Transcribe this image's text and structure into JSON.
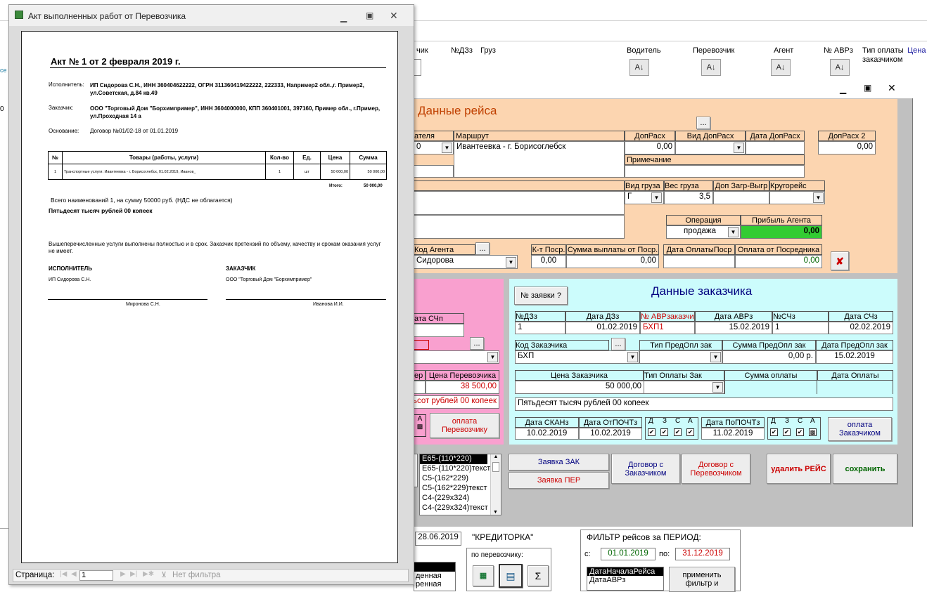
{
  "bg_headers": {
    "col1": "чик",
    "col2": "№ДЗз",
    "col3": "Груз",
    "col4": "Водитель",
    "col5": "Перевозчик",
    "col6": "Агент",
    "col7": "№ АВРз",
    "col8": "Тип оплаты заказчиком",
    "col9": "Цена"
  },
  "reis": {
    "title": "Данные рейса",
    "hdr_driver": "ателя",
    "hdr_route": "Маршрут",
    "hdr_dopras": "ДопРасх",
    "hdr_vid_dopras": "Вид ДопРасх",
    "hdr_date_dopras": "Дата ДопРасх",
    "hdr_dopras2": "ДопРасх 2",
    "driver_val": "0",
    "route_val": "Ивантеевка - г. Борисоглебск",
    "dopras_val": "0,00",
    "dopras2_val": "0,00",
    "hdr_note": "Примечание",
    "note_val": "",
    "hdr_vid_gruza": "Вид груза",
    "hdr_ves": "Вес груза",
    "hdr_dop_zagr": "Доп Загр-Выгр",
    "hdr_krug": "Кругорейс",
    "vid_gruza_val": "Г",
    "ves_val": "3,5",
    "hdr_operacia": "Операция",
    "hdr_pribyl": "Прибыль Агента",
    "operacia_val": "продажа",
    "pribyl_val": "0,00",
    "hdr_kod_agenta": "Код Агента",
    "kod_agenta_val": "Сидорова",
    "hdr_kt": "К-т Поср.",
    "hdr_summa_vypl": "Сумма выплаты от Поср.",
    "hdr_data_opl_posr": "Дата ОплатыПоср",
    "hdr_opl_ot_posr": "Оплата от Посредника",
    "kt_val": "0,00",
    "summa_vypl_val": "0,00",
    "opl_ot_posr_val": "0,00",
    "ellipsis": "..."
  },
  "carrier": {
    "hdr_data_schp": "ата СЧп",
    "hdr_nomer": "ер",
    "hdr_cena": "Цена Перевозчика",
    "cena_val": "38 500,00",
    "words": "тьсот рублей 00 копеек",
    "a_label": "А",
    "opl_button": "оплата Перевозчику"
  },
  "customer": {
    "title": "Данные заказчика",
    "zayavki_btn": "№ заявки ?",
    "hdr_ndzz": "№ДЗз",
    "hdr_data_dzz": "Дата ДЗз",
    "hdr_avr": "№ АВРзаказчи",
    "hdr_data_avr": "Дата АВРз",
    "hdr_nsch": "№СЧз",
    "hdr_data_sch": "Дата СЧз",
    "ndzz_val": "1",
    "data_dzz_val": "01.02.2019",
    "avr_val": "БХП1",
    "data_avr_val": "15.02.2019",
    "nsch_val": "1",
    "data_sch_val": "02.02.2019",
    "hdr_kod": "Код Заказчика",
    "hdr_tip_predopl": "Тип ПредОпл зак",
    "hdr_summa_predopl": "Сумма ПредОпл зак",
    "hdr_data_predopl": "Дата ПредОпл зак",
    "kod_val": "БХП",
    "summa_predopl_val": "0,00 р.",
    "data_predopl_val": "15.02.2019",
    "hdr_cena": "Цена Заказчика",
    "hdr_tip_opl": "Тип Оплаты Зак",
    "hdr_summa_opl": "Сумма оплаты",
    "hdr_data_opl": "Дата Оплаты",
    "cena_val": "50 000,00",
    "words": "Пятьдесят тысяч рублей 00 копеек",
    "hdr_data_skan": "Дата СКАНз",
    "hdr_data_otpocht": "Дата ОтПОЧТз",
    "hdr_data_popocht": "Дата ПоПОЧТз",
    "data_skan_val": "10.02.2019",
    "data_otpocht_val": "10.02.2019",
    "data_popocht_val": "11.02.2019",
    "d": "Д",
    "z": "З",
    "s": "С",
    "a": "А",
    "opl_button": "оплата Заказчиком"
  },
  "envelopes": [
    "Е65-(110*220)",
    "Е65-(110*220)текст",
    "С5-(162*229)",
    "С5-(162*229)текст",
    "С4-(229х324)",
    "С4-(229х324)текст"
  ],
  "buttons": {
    "zayavka_zak": "Заявка ЗАК",
    "zayavka_per": "Заявка ПЕР",
    "dogovor_zak": "Договор с Заказчиком",
    "dogovor_per": "Договор с Перевозчиком",
    "udalit": "удалить РЕЙС",
    "sohranit": "сохранить"
  },
  "bottom": {
    "date_val": "28.06.2019",
    "kreditorka": "\"КРЕДИТОРКА\"",
    "po_perevozchiku": "по перевозчику:",
    "sigma": "Σ",
    "filter_title": "ФИЛЬТР рейсов за ПЕРИОД:",
    "s_label": "с:",
    "s_val": "01.01.2019",
    "po_label": "по:",
    "po_val": "31.12.2019",
    "filter_opts": [
      "ДатаНачалаРейса",
      "ДатаАВРз"
    ],
    "primenit": "применить фильтр и",
    "left_list": [
      "",
      "денная",
      "ренная"
    ]
  },
  "report": {
    "window_title": "Акт выполненных работ от Перевозчика",
    "title": "Акт № 1 от 2 февраля 2019 г.",
    "ispolnitel_label": "Исполнитель:",
    "ispolnitel_val": "ИП Сидорова С.Н., ИНН 360404622222, ОГРН 311360419422222, 222333,  Например2 обл.,г. Пример2, ул.Советская, д.84 кв.49",
    "zakazchik_label": "Заказчик:",
    "zakazchik_val": "ООО \"Торговый Дом \"Борхимпример\", ИНН 3604000000, КПП 360401001, 397160, Пример обл., г.Пример, ул.Проходная 14 а",
    "osnovanie_label": "Основание:",
    "osnovanie_val": "Договор №01/02-18 от 01.01.2019",
    "th": [
      "№",
      "Товары (работы, услуги)",
      "Кол-во",
      "Ед.",
      "Цена",
      "Сумма"
    ],
    "row": [
      "1",
      "Транспортные услуги: Ивантеевка - г. Борисоглебск, 01.02.2019, Иванов_",
      "1",
      "шт",
      "50 000,00",
      "50 000,00"
    ],
    "itogo_label": "Итого:",
    "itogo_val": "50 000,00",
    "vsego": "Всего наименований 1, на сумму 50000 руб. (НДС не облагается)",
    "words": "Пятьдесят тысяч рублей 00 копеек",
    "statement": "Вышеперечисленные услуги выполнены полностью и в срок. Заказчик претензий по объему, качеству и срокам оказания услуг не имеет.",
    "isp_head": "ИСПОЛНИТЕЛЬ",
    "isp_name": "ИП Сидорова С.Н.",
    "zak_head": "ЗАКАЗЧИК",
    "zak_name": "ООО \"Торговый Дом \"Борхимпример\"",
    "sign1": "Миронова С.Н.",
    "sign2": "Иванова И.И.",
    "page_label": "Страница:",
    "page_val": "1",
    "no_filter": "Нет фильтра"
  },
  "colors": {
    "orange": "#fcd5b0",
    "pink": "#f9a0cf",
    "cyan": "#ccfcfc",
    "green": "#33cc33",
    "dark_red": "#cc0000"
  }
}
